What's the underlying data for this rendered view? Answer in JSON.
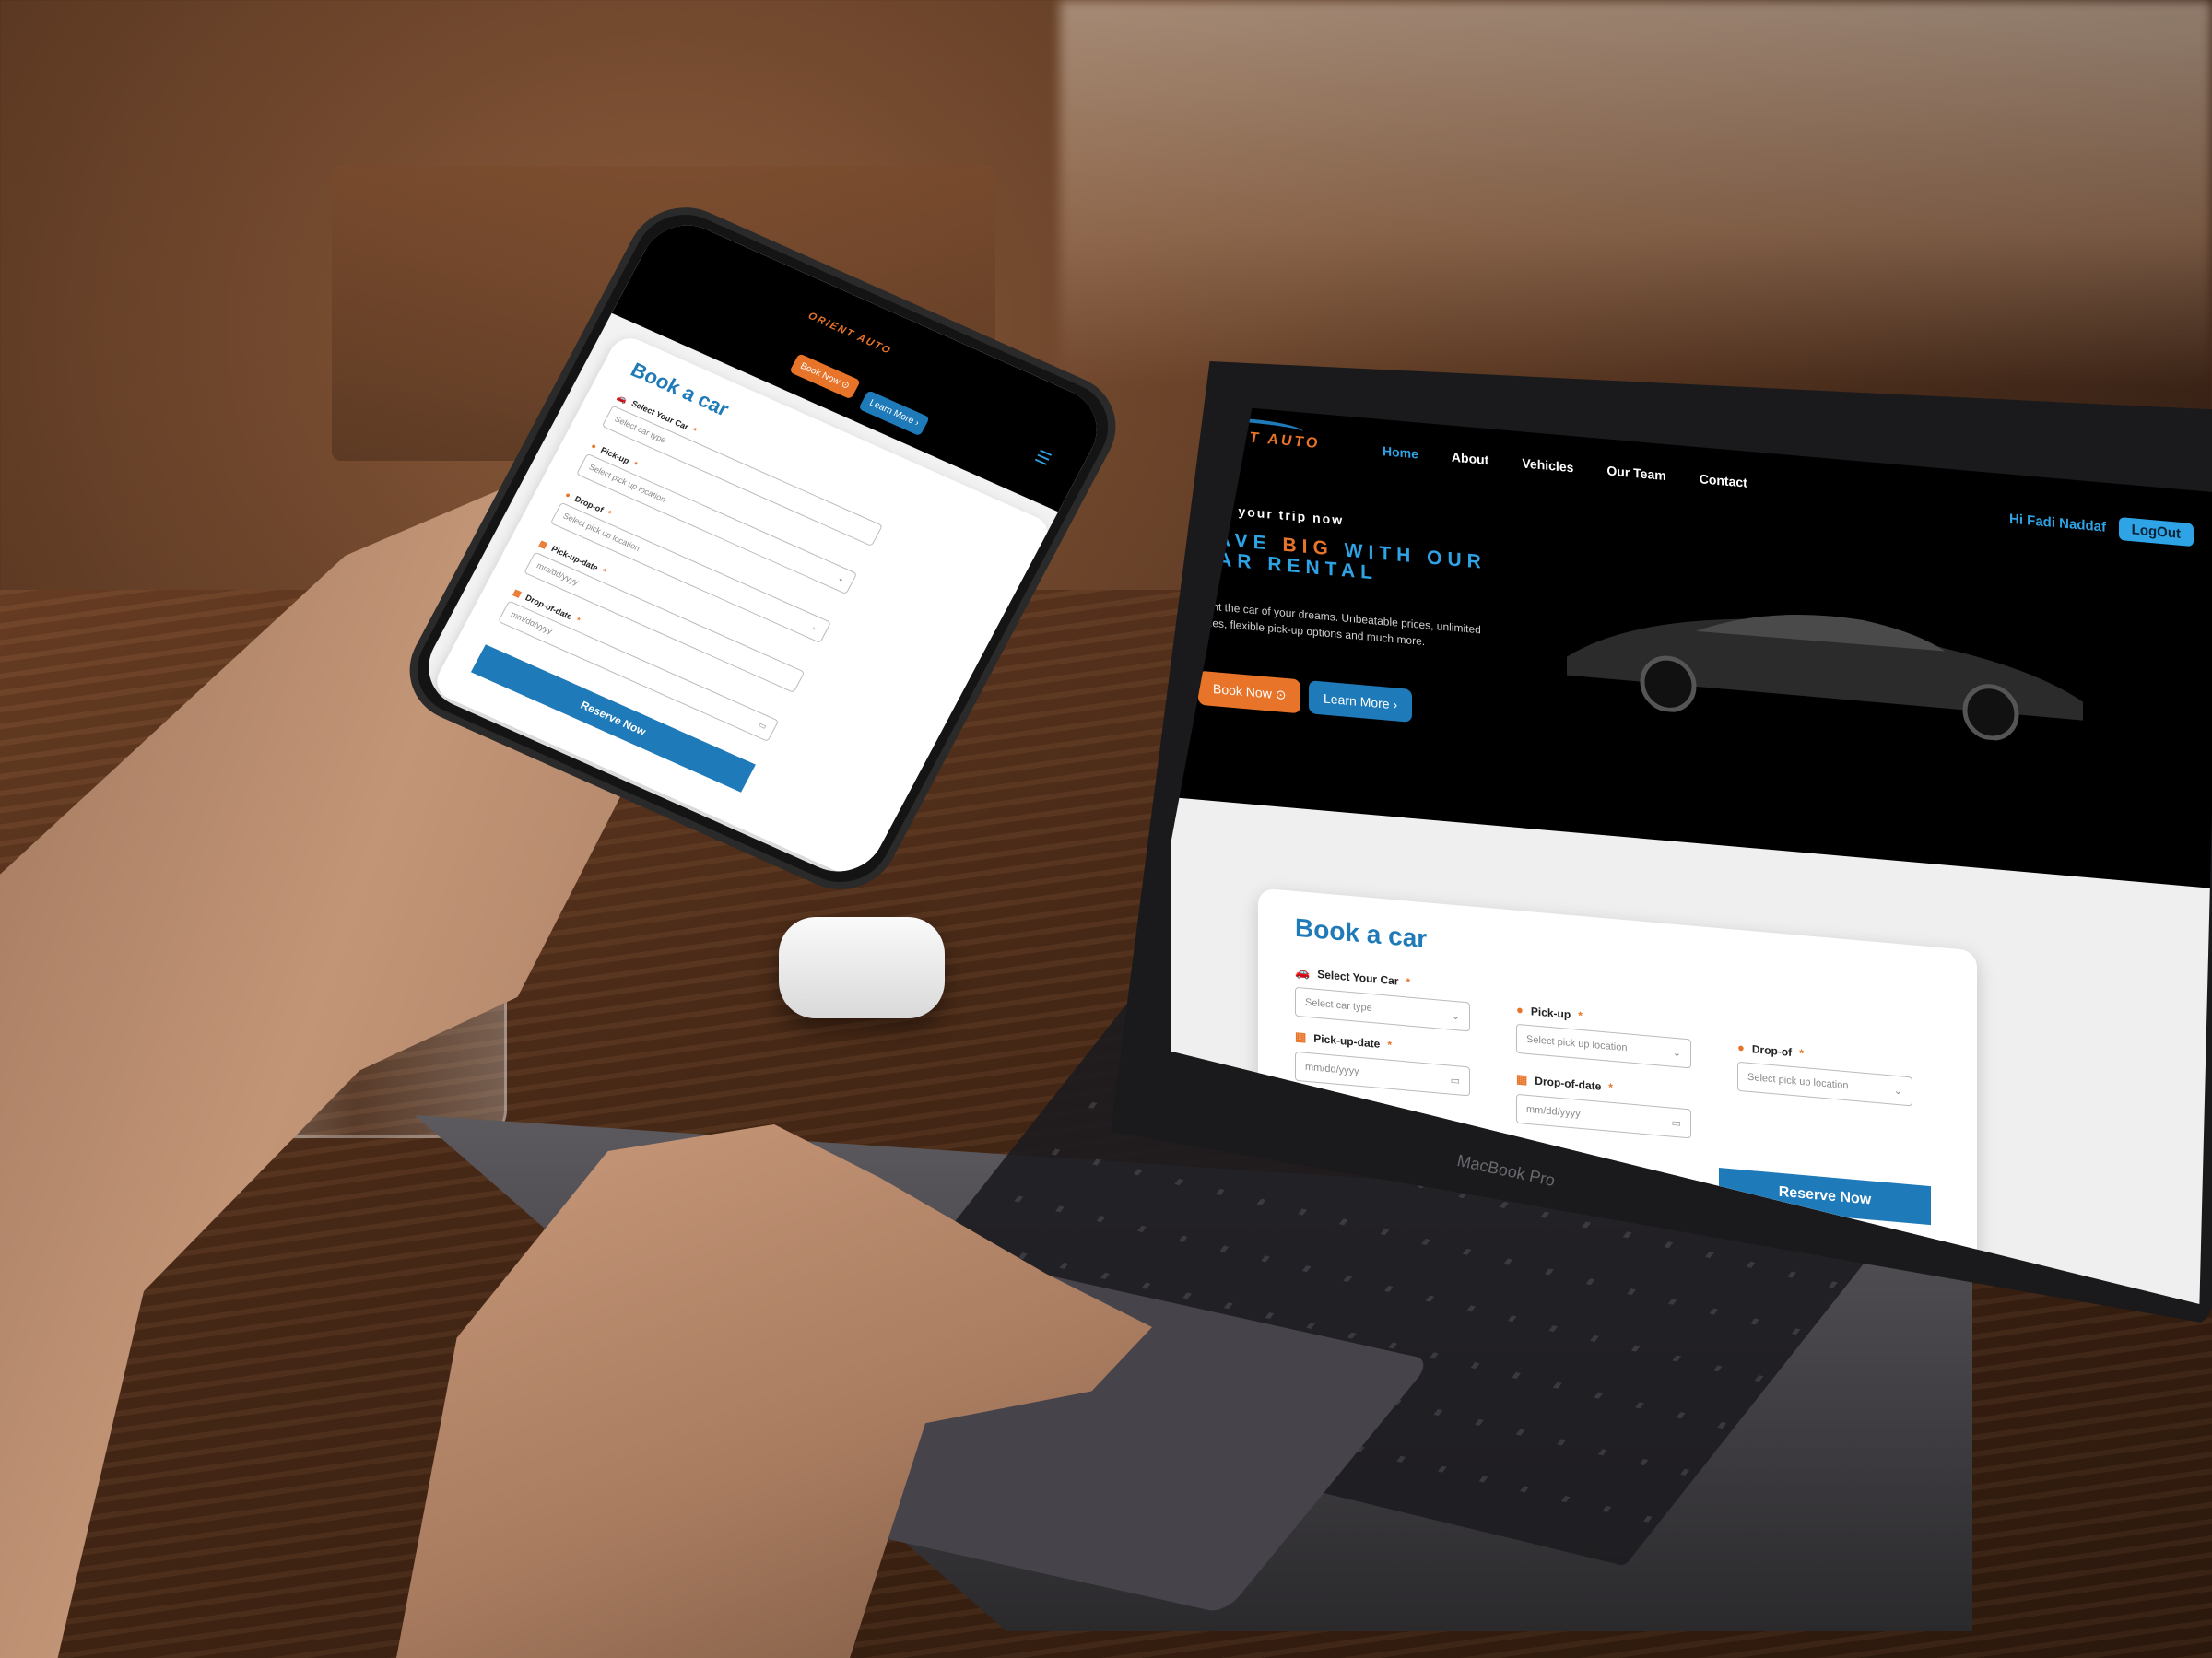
{
  "brand": {
    "logo_text": "ORIENT AUTO"
  },
  "colors": {
    "accent_orange": "#e8742a",
    "accent_blue": "#1e7ab8",
    "link_blue": "#2ea3e6",
    "hero_bg": "#000000",
    "section_bg": "#efefef"
  },
  "desktop": {
    "nav": {
      "items": [
        "Home",
        "About",
        "Vehicles",
        "Our Team",
        "Contact"
      ],
      "active": "Home"
    },
    "user": {
      "greeting": "Hi Fadi Naddaf",
      "logout_label": "LogOut"
    },
    "hero": {
      "subtitle": "Plan your trip now",
      "title_words": [
        "SAVE",
        "BIG",
        "WITH",
        "OUR",
        "CAR",
        "RENTAL"
      ],
      "title_highlight": "BIG",
      "description": "Rent the car of your dreams. Unbeatable prices, unlimited miles, flexible pick-up options and much more.",
      "book_now_label": "Book Now",
      "learn_more_label": "Learn More"
    },
    "booking": {
      "title": "Book a car",
      "fields": {
        "car": {
          "label": "Select Your Car",
          "required": "*",
          "placeholder": "Select car type",
          "icon": "car-icon"
        },
        "pickup": {
          "label": "Pick-up",
          "required": "*",
          "placeholder": "Select pick up location",
          "icon": "location-pin-icon"
        },
        "dropoff": {
          "label": "Drop-of",
          "required": "*",
          "placeholder": "Select pick up location",
          "icon": "location-pin-icon"
        },
        "pickup_date": {
          "label": "Pick-up-date",
          "required": "*",
          "placeholder": "mm/dd/yyyy",
          "icon": "calendar-icon"
        },
        "dropoff_date": {
          "label": "Drop-of-date",
          "required": "*",
          "placeholder": "mm/dd/yyyy",
          "icon": "calendar-icon"
        }
      },
      "reserve_label": "Reserve Now"
    }
  },
  "mobile": {
    "book_now_label": "Book Now",
    "learn_more_label": "Learn More",
    "booking": {
      "title": "Book a car",
      "fields": {
        "car": {
          "label": "Select Your Car",
          "required": "*",
          "placeholder": "Select car type"
        },
        "pickup": {
          "label": "Pick-up",
          "required": "*",
          "placeholder": "Select pick up location"
        },
        "dropoff": {
          "label": "Drop-of",
          "required": "*",
          "placeholder": "Select pick up location"
        },
        "pickup_date": {
          "label": "Pick-up-date",
          "required": "*",
          "placeholder": "mm/dd/yyyy"
        },
        "dropoff_date": {
          "label": "Drop-of-date",
          "required": "*",
          "placeholder": "mm/dd/yyyy"
        }
      },
      "reserve_label": "Reserve Now"
    }
  },
  "device_labels": {
    "laptop_brand": "MacBook Pro"
  }
}
